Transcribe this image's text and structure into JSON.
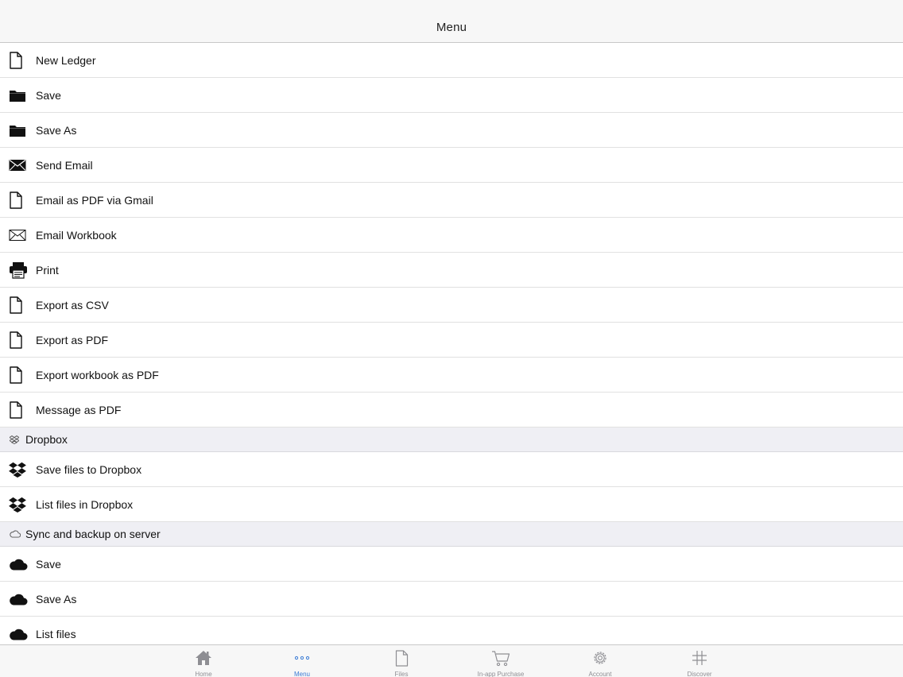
{
  "navbar": {
    "title": "Menu"
  },
  "menu": {
    "items": [
      {
        "label": "New Ledger",
        "icon": "document-icon"
      },
      {
        "label": "Save",
        "icon": "folder-icon"
      },
      {
        "label": "Save As",
        "icon": "folder-icon"
      },
      {
        "label": "Send Email",
        "icon": "envelope-filled-icon"
      },
      {
        "label": "Email as PDF via Gmail",
        "icon": "document-icon"
      },
      {
        "label": "Email Workbook",
        "icon": "envelope-outline-icon"
      },
      {
        "label": "Print",
        "icon": "printer-icon"
      },
      {
        "label": "Export as CSV",
        "icon": "document-icon"
      },
      {
        "label": "Export as PDF",
        "icon": "document-icon"
      },
      {
        "label": "Export workbook as PDF",
        "icon": "document-icon"
      },
      {
        "label": "Message as PDF",
        "icon": "document-icon"
      }
    ]
  },
  "dropbox": {
    "header": "Dropbox",
    "header_icon": "dropbox-outline-icon",
    "items": [
      {
        "label": "Save files to Dropbox",
        "icon": "dropbox-icon"
      },
      {
        "label": "List files in Dropbox",
        "icon": "dropbox-icon"
      }
    ]
  },
  "sync": {
    "header": "Sync and backup on server",
    "header_icon": "cloud-outline-icon",
    "items": [
      {
        "label": "Save",
        "icon": "cloud-icon"
      },
      {
        "label": "Save As",
        "icon": "cloud-icon"
      },
      {
        "label": "List files",
        "icon": "cloud-icon"
      }
    ]
  },
  "tabbar": {
    "active": "Menu",
    "active_color": "#3a7bd5",
    "inactive_color": "#8e8e93",
    "tabs": [
      {
        "label": "Home",
        "icon": "home-icon"
      },
      {
        "label": "Menu",
        "icon": "more-dots-icon"
      },
      {
        "label": "Files",
        "icon": "file-icon"
      },
      {
        "label": "In-app Purchase",
        "icon": "cart-icon"
      },
      {
        "label": "Account",
        "icon": "gear-icon"
      },
      {
        "label": "Discover",
        "icon": "hashtag-icon"
      }
    ]
  }
}
